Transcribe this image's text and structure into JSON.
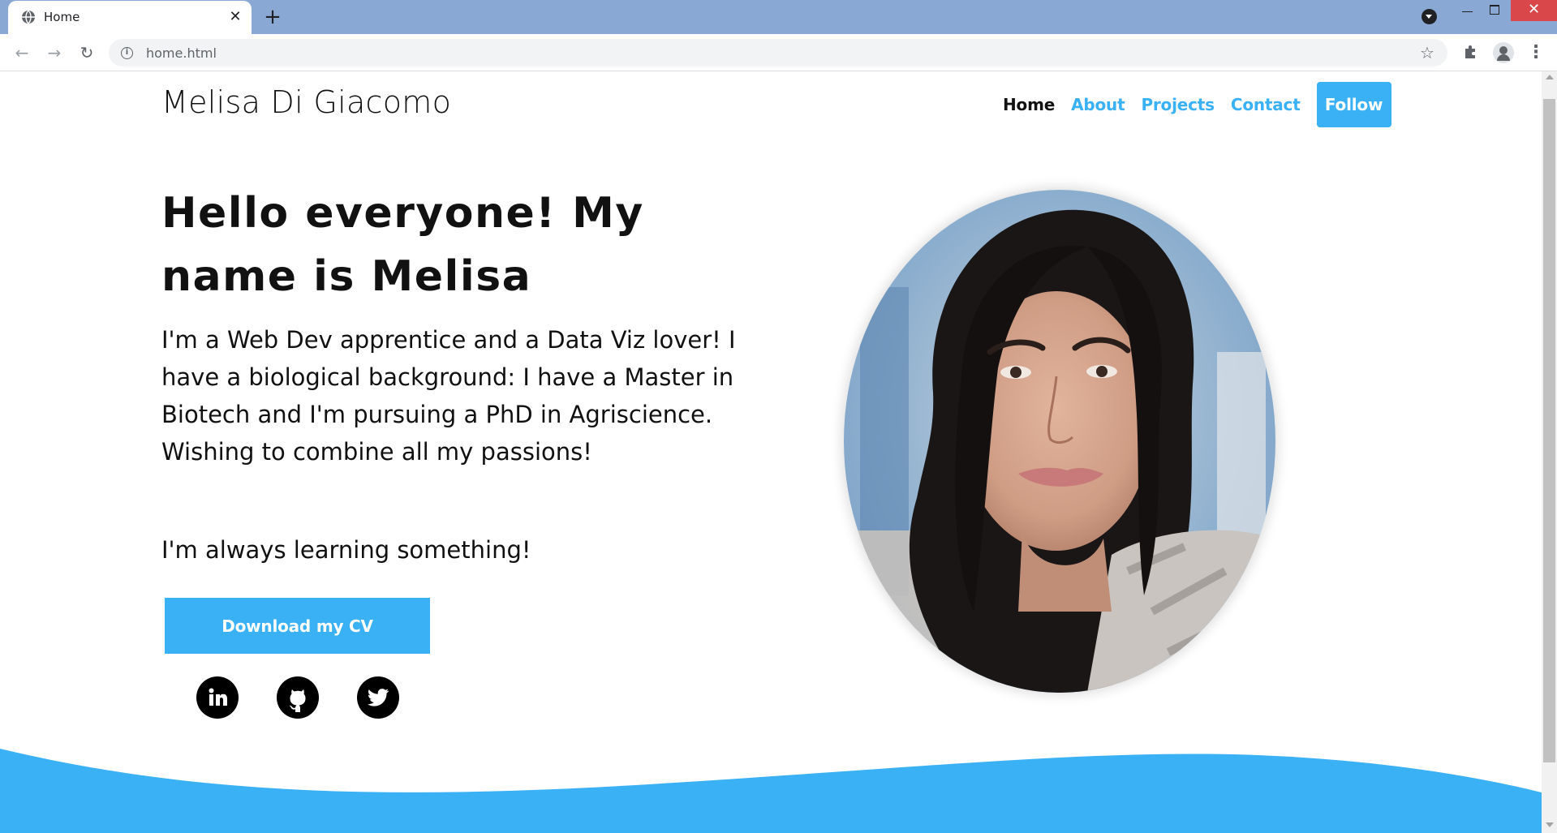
{
  "browser": {
    "tab_title": "Home",
    "tab_close": "✕",
    "new_tab": "+",
    "url": "home.html",
    "window_close": "✕"
  },
  "site": {
    "brand": "Melisa Di Giacomo",
    "nav": [
      {
        "label": "Home",
        "active": true
      },
      {
        "label": "About",
        "active": false
      },
      {
        "label": "Projects",
        "active": false
      },
      {
        "label": "Contact",
        "active": false
      }
    ],
    "follow_label": "Follow"
  },
  "hero": {
    "title": "Hello everyone! My name is Melisa",
    "text": "I'm a Web Dev apprentice and a Data Viz lover! I have a biological background: I have a Master in Biotech and I'm pursuing a PhD in Agriscience. Wishing to combine all my passions!",
    "subtext": "I'm always learning something!",
    "cv_button": "Download my CV"
  },
  "social": [
    {
      "name": "linkedin-icon"
    },
    {
      "name": "github-icon"
    },
    {
      "name": "twitter-icon"
    }
  ],
  "colors": {
    "accent": "#3ab0f5",
    "tabbar": "#89a8d4",
    "text": "#111111"
  }
}
